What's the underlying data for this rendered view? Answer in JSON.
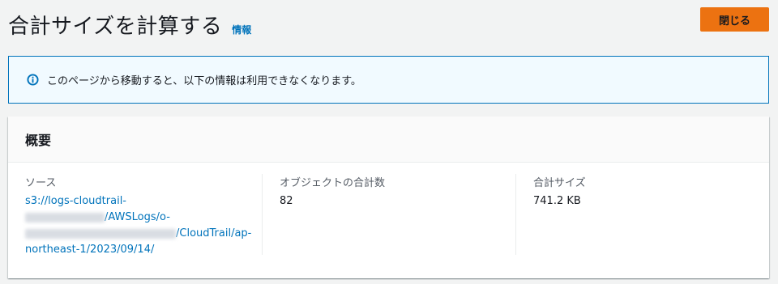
{
  "header": {
    "title": "合計サイズを計算する",
    "info_link": "情報",
    "close_button": "閉じる"
  },
  "alert": {
    "message": "このページから移動すると、以下の情報は利用できなくなります。",
    "icon": "info-icon"
  },
  "summary": {
    "title": "概要",
    "source": {
      "label": "ソース",
      "line1": "s3://logs-cloudtrail-",
      "line2_suffix": "/AWSLogs/o-",
      "line3_suffix": "/CloudTrail/ap-",
      "line4": "northeast-1/2023/09/14/"
    },
    "object_count": {
      "label": "オブジェクトの合計数",
      "value": "82"
    },
    "total_size": {
      "label": "合計サイズ",
      "value": "741.2 KB"
    }
  },
  "colors": {
    "accent": "#ec7211",
    "link": "#0073bb",
    "alert_bg": "#f1faff"
  }
}
